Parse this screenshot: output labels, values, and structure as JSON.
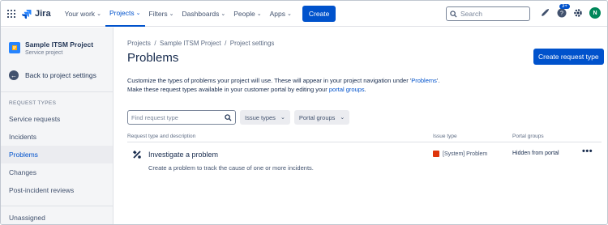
{
  "topnav": {
    "logo_text": "Jira",
    "items": [
      {
        "label": "Your work"
      },
      {
        "label": "Projects"
      },
      {
        "label": "Filters"
      },
      {
        "label": "Dashboards"
      },
      {
        "label": "People"
      },
      {
        "label": "Apps"
      }
    ],
    "create_label": "Create",
    "search_placeholder": "Search",
    "notification_count": "3+",
    "avatar_initial": "N",
    "accent": "#0052cc"
  },
  "sidebar": {
    "project_name": "Sample ITSM Project",
    "project_type": "Service project",
    "back_label": "Back to project settings",
    "section_label": "REQUEST TYPES",
    "items": [
      {
        "label": "Service requests"
      },
      {
        "label": "Incidents"
      },
      {
        "label": "Problems"
      },
      {
        "label": "Changes"
      },
      {
        "label": "Post-incident reviews"
      }
    ],
    "unassigned_label": "Unassigned"
  },
  "main": {
    "breadcrumbs": [
      "Projects",
      "Sample ITSM Project",
      "Project settings"
    ],
    "title": "Problems",
    "create_button": "Create request type",
    "desc_line1_a": "Customize the types of problems your project will use. These will appear in your project navigation under '",
    "desc_line1_link": "Problems",
    "desc_line1_b": "'.",
    "desc_line2_a": "Make these request types available in your customer portal by editing your ",
    "desc_line2_link": "portal groups",
    "desc_line2_b": ".",
    "find_placeholder": "Find request type",
    "filter_issue_types": "Issue types",
    "filter_portal_groups": "Portal groups",
    "columns": {
      "type_desc": "Request type and description",
      "issue_type": "Issue type",
      "portal_groups": "Portal groups"
    },
    "rows": [
      {
        "name": "Investigate a problem",
        "description": "Create a problem to track the cause of one or more incidents.",
        "issue_type": "[System] Problem",
        "portal": "Hidden from portal"
      }
    ]
  }
}
